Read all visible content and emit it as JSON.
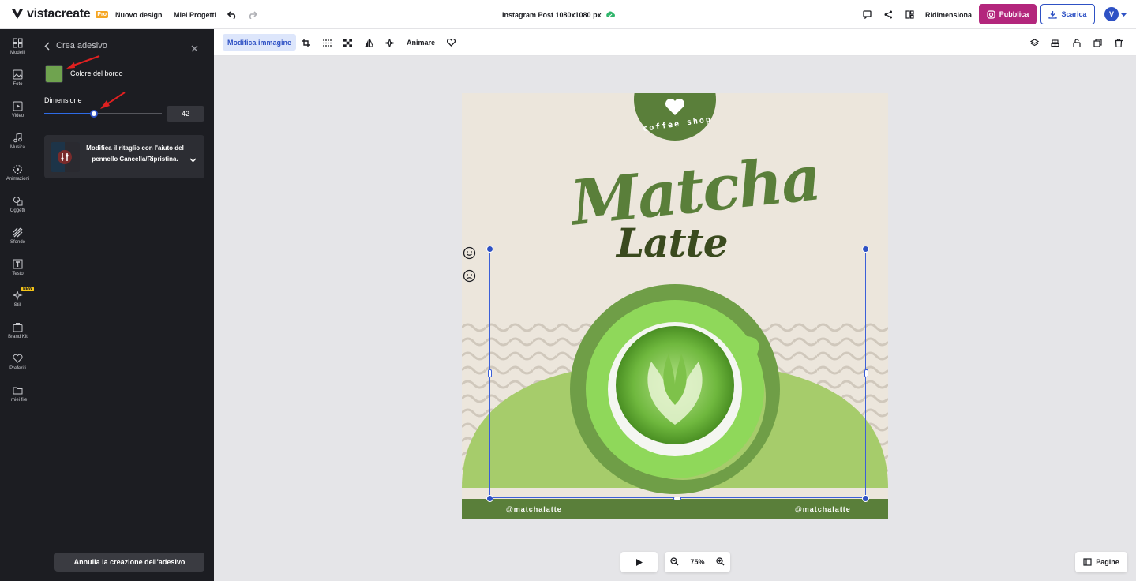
{
  "app": {
    "logo": "vistacreate",
    "pro_badge": "Pro"
  },
  "topbar": {
    "nuovo_design": "Nuovo design",
    "miei_progetti": "Miei Progetti",
    "doc_title": "Instagram Post 1080x1080 px",
    "ridimensiona": "Ridimensiona",
    "pubblica": "Pubblica",
    "scarica": "Scarica",
    "avatar": "V"
  },
  "leftnav": {
    "items": [
      {
        "label": "Modelli",
        "icon": "grid-icon"
      },
      {
        "label": "Foto",
        "icon": "image-icon"
      },
      {
        "label": "Video",
        "icon": "video-icon"
      },
      {
        "label": "Musica",
        "icon": "music-icon"
      },
      {
        "label": "Animazioni",
        "icon": "animation-icon"
      },
      {
        "label": "Oggetti",
        "icon": "shapes-icon"
      },
      {
        "label": "Sfondo",
        "icon": "background-icon"
      },
      {
        "label": "Testo",
        "icon": "text-icon"
      },
      {
        "label": "Stili",
        "icon": "sparkle-icon",
        "badge": "NEW"
      },
      {
        "label": "Brand Kit",
        "icon": "briefcase-icon"
      },
      {
        "label": "Preferiti",
        "icon": "heart-icon"
      },
      {
        "label": "I miei file",
        "icon": "folder-icon"
      }
    ]
  },
  "panel": {
    "title": "Crea adesivo",
    "border_color_label": "Colore del bordo",
    "border_color": "#6fa34f",
    "dimension_label": "Dimensione",
    "dimension_value": "42",
    "dimension_fraction": 0.42,
    "card_text": "Modifica il ritaglio con l'aiuto del pennello Cancella/Ripristina.",
    "cancel_button": "Annulla la creazione dell'adesivo"
  },
  "toolbar": {
    "edit_image": "Modifica immagine",
    "animate": "Animare"
  },
  "canvas": {
    "coffee_shop": "coffee shop",
    "title_line1": "Matcha",
    "title_line2": "Latte",
    "handle_left": "@matchalatte",
    "handle_right": "@matchalatte",
    "colors": {
      "dark_green": "#5a7f3a",
      "light_green": "#a6cc6b",
      "cream": "#ece6dc"
    }
  },
  "bottom": {
    "zoom": "75%",
    "pages": "Pagine"
  }
}
